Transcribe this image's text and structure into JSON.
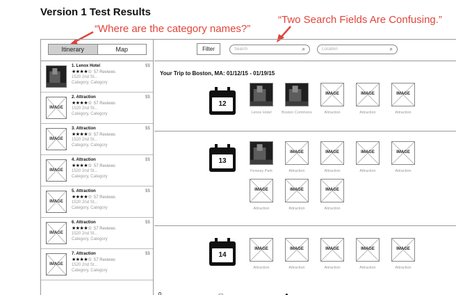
{
  "title": "Version 1 Test Results",
  "annotations": {
    "category": "“Where are the category names?”",
    "search": "“Two Search Fields Are Confusing.”"
  },
  "colors": {
    "annotation": "#e0453a",
    "active_tab": "#cfcfcf"
  },
  "tabs": [
    {
      "label": "Itinerary",
      "active": true
    },
    {
      "label": "Map",
      "active": false
    }
  ],
  "toolbar": {
    "filter_label": "Filter",
    "search_placeholder": "Search",
    "location_placeholder": "Location",
    "search_icon": "magnifier-icon"
  },
  "list": [
    {
      "name": "1. Lenox Hotel",
      "stars": "★★★★☆",
      "reviews": "57 Reviews",
      "address": "1520 2nd St...",
      "category": "Category, Category",
      "price": "$$",
      "image": "photo"
    },
    {
      "name": "2. Attraction",
      "stars": "★★★★☆",
      "reviews": "57 Reviews",
      "address": "1520 2nd St...",
      "category": "Category, Category",
      "price": "$$",
      "image": "IMAGE"
    },
    {
      "name": "3. Attraction",
      "stars": "★★★★☆",
      "reviews": "57 Reviews",
      "address": "1520 2nd St...",
      "category": "Category, Category",
      "price": "$$",
      "image": "IMAGE"
    },
    {
      "name": "4. Attraction",
      "stars": "★★★★☆",
      "reviews": "57 Reviews",
      "address": "1520 2nd St...",
      "category": "Category, Category",
      "price": "$$",
      "image": "IMAGE"
    },
    {
      "name": "5. Attraction",
      "stars": "★★★★☆",
      "reviews": "57 Reviews",
      "address": "1520 2nd St...",
      "category": "Category, Category",
      "price": "$$",
      "image": "IMAGE"
    },
    {
      "name": "6. Attraction",
      "stars": "★★★★☆",
      "reviews": "57 Reviews",
      "address": "1520 2nd St...",
      "category": "Category, Category",
      "price": "$$",
      "image": "IMAGE"
    },
    {
      "name": "7. Attraction",
      "stars": "★★★★☆",
      "reviews": "57 Reviews",
      "address": "1520 2nd St...",
      "category": "Category, Category",
      "price": "$$",
      "image": "IMAGE"
    }
  ],
  "trip": {
    "title": "Your Trip to Boston, MA: 01/12/15 - 01/19/15",
    "days": [
      {
        "date": "12",
        "items": [
          {
            "caption": "Lenox Hotel",
            "image": "photo"
          },
          {
            "caption": "Boston Commons",
            "image": "photo"
          },
          {
            "caption": "Attraction",
            "image": "IMAGE"
          },
          {
            "caption": "Attraction",
            "image": "IMAGE"
          },
          {
            "caption": "Attraction",
            "image": "IMAGE"
          }
        ]
      },
      {
        "date": "13",
        "items": [
          {
            "caption": "Fenway Park",
            "image": "photo"
          },
          {
            "caption": "Attraction",
            "image": "IMAGE"
          },
          {
            "caption": "Attraction",
            "image": "IMAGE"
          },
          {
            "caption": "Attraction",
            "image": "IMAGE"
          },
          {
            "caption": "Attraction",
            "image": "IMAGE"
          },
          {
            "caption": "Attraction",
            "image": "IMAGE"
          },
          {
            "caption": "Attraction",
            "image": "IMAGE"
          },
          {
            "caption": "Attraction",
            "image": "IMAGE"
          }
        ]
      },
      {
        "date": "14",
        "items": [
          {
            "caption": "Attraction",
            "image": "IMAGE"
          },
          {
            "caption": "Attraction",
            "image": "IMAGE"
          },
          {
            "caption": "Attraction",
            "image": "IMAGE"
          },
          {
            "caption": "Attraction",
            "image": "IMAGE"
          },
          {
            "caption": "Attraction",
            "image": "IMAGE"
          }
        ]
      }
    ]
  }
}
